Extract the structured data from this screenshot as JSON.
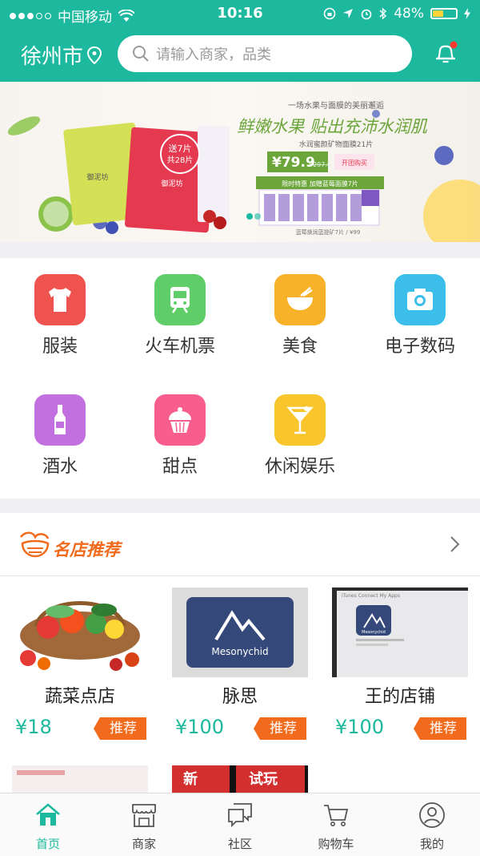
{
  "statusbar": {
    "carrier": "中国移动",
    "time": "10:16",
    "battery": "48%",
    "battery_level": 0.48
  },
  "header": {
    "city": "徐州市",
    "search_placeholder": "请输入商家，品类"
  },
  "banner": {
    "tagline": "一场水果与面膜的美丽邂逅",
    "headline": "鲜嫩水果 贴出充沛水润肌",
    "sub": "水润蜜颜矿物面膜21片",
    "price": "¥79.9",
    "old_price": "¥297.0",
    "buy_btn": "开团购买",
    "promo": "限时特惠  加赠蓝莓面膜7片",
    "promo_note": "蓝莓焕润蓝提矿7片 / ¥99",
    "gift_line1": "送7片",
    "gift_line2": "共28片",
    "box_text": "御泥坊"
  },
  "categories": [
    {
      "label": "服装",
      "icon": "tshirt-icon",
      "color": "#ef5350"
    },
    {
      "label": "火车机票",
      "icon": "train-icon",
      "color": "#5fce69"
    },
    {
      "label": "美食",
      "icon": "bowl-icon",
      "color": "#f7b22a"
    },
    {
      "label": "电子数码",
      "icon": "camera-icon",
      "color": "#3bbfea"
    },
    {
      "label": "酒水",
      "icon": "bottle-icon",
      "color": "#c26fe0"
    },
    {
      "label": "甜点",
      "icon": "cupcake-icon",
      "color": "#f75e8d"
    },
    {
      "label": "休闲娱乐",
      "icon": "cocktail-icon",
      "color": "#f8c62c"
    }
  ],
  "section": {
    "title": "名店推荐"
  },
  "shops": [
    {
      "name": "蔬菜点店",
      "price": "¥18",
      "tag": "推荐"
    },
    {
      "name": "脉思",
      "price": "¥100",
      "tag": "推荐",
      "img_text": "Mesonychid"
    },
    {
      "name": "王的店铺",
      "price": "¥100",
      "tag": "推荐",
      "img_text": "Mesonychid",
      "img_caption": "iTunes Connect  My Apps"
    }
  ],
  "row2": {
    "label1": "新",
    "label2": "试玩"
  },
  "tabs": [
    {
      "label": "首页",
      "icon": "home-icon",
      "active": true
    },
    {
      "label": "商家",
      "icon": "shop-icon"
    },
    {
      "label": "社区",
      "icon": "chat-icon"
    },
    {
      "label": "购物车",
      "icon": "cart-icon"
    },
    {
      "label": "我的",
      "icon": "user-icon"
    }
  ],
  "colors": {
    "primary": "#1cb99f",
    "accent": "#f26a1b"
  }
}
